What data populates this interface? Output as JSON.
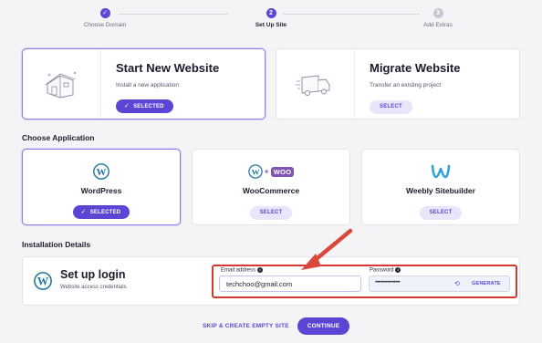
{
  "stepper": {
    "steps": [
      {
        "number": "✓",
        "label": "Choose Domain",
        "state": "done"
      },
      {
        "number": "2",
        "label": "Set Up Site",
        "state": "active"
      },
      {
        "number": "3",
        "label": "Add Extras",
        "state": "todo"
      }
    ]
  },
  "site_type": {
    "start": {
      "title": "Start New Website",
      "subtitle": "Install a new application",
      "button": "SELECTED",
      "icon": "house-icon"
    },
    "migrate": {
      "title": "Migrate Website",
      "subtitle": "Transfer an existing project",
      "button": "SELECT",
      "icon": "moving-truck-icon"
    }
  },
  "choose_application": {
    "heading": "Choose Application",
    "apps": [
      {
        "name": "WordPress",
        "button": "SELECTED",
        "selected": true,
        "icon": "wordpress-icon"
      },
      {
        "name": "WooCommerce",
        "button": "SELECT",
        "selected": false,
        "icon": "woocommerce-icon",
        "logo_plus": "+",
        "logo_text": "WOO"
      },
      {
        "name": "Weebly Sitebuilder",
        "button": "SELECT",
        "selected": false,
        "icon": "weebly-icon"
      }
    ]
  },
  "installation": {
    "heading": "Installation Details",
    "title": "Set up login",
    "subtitle": "Website access credentials",
    "email_label": "Email address",
    "email_value": "techchoo@gmail.com",
    "password_label": "Password",
    "password_value": "••••••••••••••••",
    "generate_label": "GENERATE"
  },
  "footer": {
    "skip_label": "SKIP & CREATE EMPTY SITE",
    "continue_label": "CONTINUE"
  },
  "colors": {
    "accent": "#5b46d4",
    "highlight": "#d43a32",
    "background": "#f4f4f7"
  }
}
